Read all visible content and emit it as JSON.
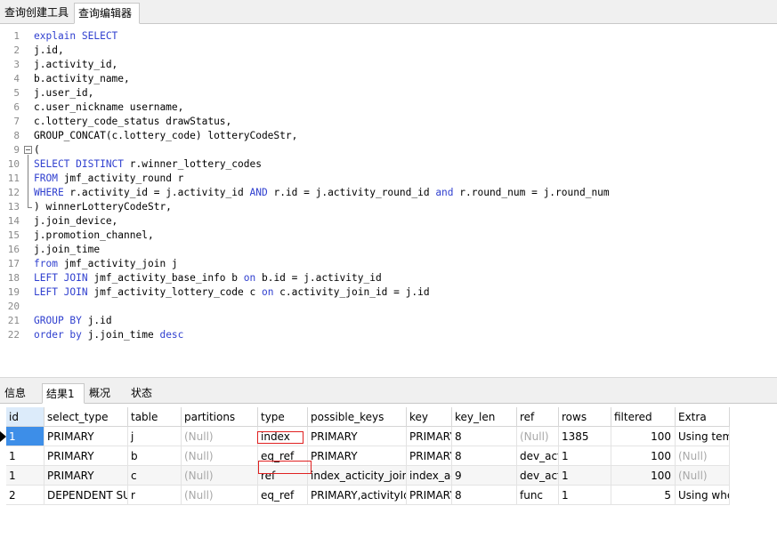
{
  "tabs": {
    "query_builder": "查询创建工具",
    "query_editor": "查询编辑器"
  },
  "editor": {
    "lines": [
      {
        "n": "1",
        "tokens": [
          {
            "t": "explain SELECT",
            "k": true
          }
        ]
      },
      {
        "n": "2",
        "tokens": [
          {
            "t": "j.id,",
            "k": false
          }
        ]
      },
      {
        "n": "3",
        "tokens": [
          {
            "t": "j.activity_id,",
            "k": false
          }
        ]
      },
      {
        "n": "4",
        "tokens": [
          {
            "t": "b.activity_name,",
            "k": false
          }
        ]
      },
      {
        "n": "5",
        "tokens": [
          {
            "t": "j.user_id,",
            "k": false
          }
        ]
      },
      {
        "n": "6",
        "tokens": [
          {
            "t": "c.user_nickname username,",
            "k": false
          }
        ]
      },
      {
        "n": "7",
        "tokens": [
          {
            "t": "c.lottery_code_status drawStatus,",
            "k": false
          }
        ]
      },
      {
        "n": "8",
        "tokens": [
          {
            "t": "GROUP_CONCAT(c.lottery_code) lotteryCodeStr,",
            "k": false
          }
        ]
      },
      {
        "n": "9",
        "tokens": [
          {
            "t": "(",
            "k": false
          }
        ]
      },
      {
        "n": "10",
        "tokens": [
          {
            "t": "SELECT DISTINCT",
            "k": true
          },
          {
            "t": " r.winner_lottery_codes",
            "k": false
          }
        ]
      },
      {
        "n": "11",
        "tokens": [
          {
            "t": "FROM",
            "k": true
          },
          {
            "t": " jmf_activity_round r",
            "k": false
          }
        ]
      },
      {
        "n": "12",
        "tokens": [
          {
            "t": "WHERE",
            "k": true
          },
          {
            "t": " r.activity_id = j.activity_id ",
            "k": false
          },
          {
            "t": "AND",
            "k": true
          },
          {
            "t": " r.id = j.activity_round_id ",
            "k": false
          },
          {
            "t": "and",
            "k": true
          },
          {
            "t": " r.round_num = j.round_num",
            "k": false
          }
        ]
      },
      {
        "n": "13",
        "tokens": [
          {
            "t": ") winnerLotteryCodeStr,",
            "k": false
          }
        ]
      },
      {
        "n": "14",
        "tokens": [
          {
            "t": "j.join_device,",
            "k": false
          }
        ]
      },
      {
        "n": "15",
        "tokens": [
          {
            "t": "j.promotion_channel,",
            "k": false
          }
        ]
      },
      {
        "n": "16",
        "tokens": [
          {
            "t": "j.join_time",
            "k": false
          }
        ]
      },
      {
        "n": "17",
        "tokens": [
          {
            "t": "from",
            "k": true
          },
          {
            "t": " jmf_activity_join j",
            "k": false
          }
        ]
      },
      {
        "n": "18",
        "tokens": [
          {
            "t": "LEFT JOIN",
            "k": true
          },
          {
            "t": " jmf_activity_base_info b ",
            "k": false
          },
          {
            "t": "on",
            "k": true
          },
          {
            "t": " b.id = j.activity_id",
            "k": false
          }
        ]
      },
      {
        "n": "19",
        "tokens": [
          {
            "t": "LEFT JOIN",
            "k": true
          },
          {
            "t": " jmf_activity_lottery_code c ",
            "k": false
          },
          {
            "t": "on",
            "k": true
          },
          {
            "t": " c.activity_join_id = j.id",
            "k": false
          }
        ]
      },
      {
        "n": "20",
        "tokens": []
      },
      {
        "n": "21",
        "tokens": [
          {
            "t": "GROUP BY",
            "k": true
          },
          {
            "t": " j.id",
            "k": false
          }
        ]
      },
      {
        "n": "22",
        "tokens": [
          {
            "t": "order by",
            "k": true
          },
          {
            "t": " j.join_time ",
            "k": false
          },
          {
            "t": "desc",
            "k": true
          }
        ]
      }
    ]
  },
  "result_tabs": [
    "信息",
    "结果1",
    "概况",
    "状态"
  ],
  "result": {
    "columns": [
      "id",
      "select_type",
      "table",
      "partitions",
      "type",
      "possible_keys",
      "key",
      "key_len",
      "ref",
      "rows",
      "filtered",
      "Extra"
    ],
    "rows": [
      [
        "1",
        "PRIMARY",
        "j",
        "(Null)",
        "index",
        "PRIMARY",
        "PRIMARY",
        "8",
        "(Null)",
        "1385",
        "100",
        "Using temporary"
      ],
      [
        "1",
        "PRIMARY",
        "b",
        "(Null)",
        "eq_ref",
        "PRIMARY",
        "PRIMARY",
        "8",
        "dev_activity.j.activity_id",
        "1",
        "100",
        "(Null)"
      ],
      [
        "1",
        "PRIMARY",
        "c",
        "(Null)",
        "ref",
        "index_acticity_join_id",
        "index_acticity_join_id",
        "9",
        "dev_activity.j.id",
        "1",
        "100",
        "(Null)"
      ],
      [
        "2",
        "DEPENDENT SUBQUERY",
        "r",
        "(Null)",
        "eq_ref",
        "PRIMARY,activityId",
        "PRIMARY",
        "8",
        "func",
        "1",
        "5",
        "Using where"
      ]
    ]
  },
  "colors": {
    "keyword": "#2f3fcf",
    "null_text": "#a8a8a8",
    "selection": "#3d8ee8",
    "annotation": "#e02020"
  }
}
